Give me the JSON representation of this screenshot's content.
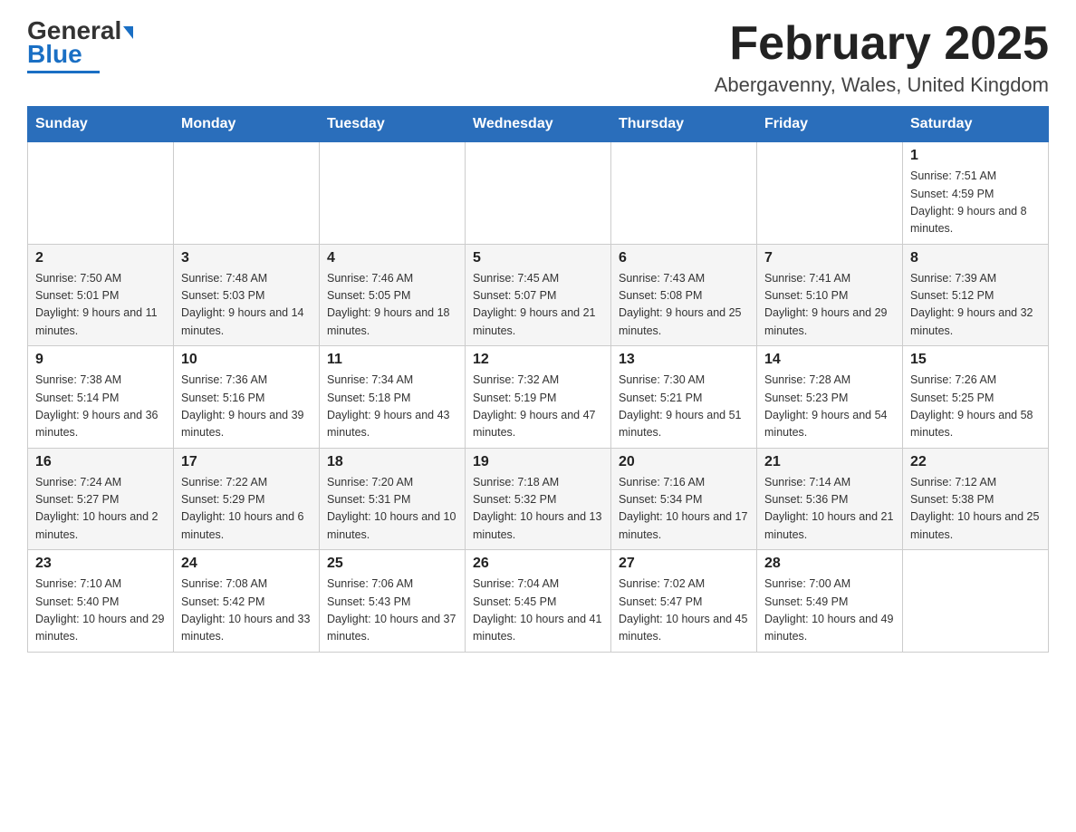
{
  "header": {
    "logo_general": "General",
    "logo_blue": "Blue",
    "month_title": "February 2025",
    "location": "Abergavenny, Wales, United Kingdom"
  },
  "days_of_week": [
    "Sunday",
    "Monday",
    "Tuesday",
    "Wednesday",
    "Thursday",
    "Friday",
    "Saturday"
  ],
  "weeks": [
    [
      {
        "day": "",
        "info": ""
      },
      {
        "day": "",
        "info": ""
      },
      {
        "day": "",
        "info": ""
      },
      {
        "day": "",
        "info": ""
      },
      {
        "day": "",
        "info": ""
      },
      {
        "day": "",
        "info": ""
      },
      {
        "day": "1",
        "info": "Sunrise: 7:51 AM\nSunset: 4:59 PM\nDaylight: 9 hours and 8 minutes."
      }
    ],
    [
      {
        "day": "2",
        "info": "Sunrise: 7:50 AM\nSunset: 5:01 PM\nDaylight: 9 hours and 11 minutes."
      },
      {
        "day": "3",
        "info": "Sunrise: 7:48 AM\nSunset: 5:03 PM\nDaylight: 9 hours and 14 minutes."
      },
      {
        "day": "4",
        "info": "Sunrise: 7:46 AM\nSunset: 5:05 PM\nDaylight: 9 hours and 18 minutes."
      },
      {
        "day": "5",
        "info": "Sunrise: 7:45 AM\nSunset: 5:07 PM\nDaylight: 9 hours and 21 minutes."
      },
      {
        "day": "6",
        "info": "Sunrise: 7:43 AM\nSunset: 5:08 PM\nDaylight: 9 hours and 25 minutes."
      },
      {
        "day": "7",
        "info": "Sunrise: 7:41 AM\nSunset: 5:10 PM\nDaylight: 9 hours and 29 minutes."
      },
      {
        "day": "8",
        "info": "Sunrise: 7:39 AM\nSunset: 5:12 PM\nDaylight: 9 hours and 32 minutes."
      }
    ],
    [
      {
        "day": "9",
        "info": "Sunrise: 7:38 AM\nSunset: 5:14 PM\nDaylight: 9 hours and 36 minutes."
      },
      {
        "day": "10",
        "info": "Sunrise: 7:36 AM\nSunset: 5:16 PM\nDaylight: 9 hours and 39 minutes."
      },
      {
        "day": "11",
        "info": "Sunrise: 7:34 AM\nSunset: 5:18 PM\nDaylight: 9 hours and 43 minutes."
      },
      {
        "day": "12",
        "info": "Sunrise: 7:32 AM\nSunset: 5:19 PM\nDaylight: 9 hours and 47 minutes."
      },
      {
        "day": "13",
        "info": "Sunrise: 7:30 AM\nSunset: 5:21 PM\nDaylight: 9 hours and 51 minutes."
      },
      {
        "day": "14",
        "info": "Sunrise: 7:28 AM\nSunset: 5:23 PM\nDaylight: 9 hours and 54 minutes."
      },
      {
        "day": "15",
        "info": "Sunrise: 7:26 AM\nSunset: 5:25 PM\nDaylight: 9 hours and 58 minutes."
      }
    ],
    [
      {
        "day": "16",
        "info": "Sunrise: 7:24 AM\nSunset: 5:27 PM\nDaylight: 10 hours and 2 minutes."
      },
      {
        "day": "17",
        "info": "Sunrise: 7:22 AM\nSunset: 5:29 PM\nDaylight: 10 hours and 6 minutes."
      },
      {
        "day": "18",
        "info": "Sunrise: 7:20 AM\nSunset: 5:31 PM\nDaylight: 10 hours and 10 minutes."
      },
      {
        "day": "19",
        "info": "Sunrise: 7:18 AM\nSunset: 5:32 PM\nDaylight: 10 hours and 13 minutes."
      },
      {
        "day": "20",
        "info": "Sunrise: 7:16 AM\nSunset: 5:34 PM\nDaylight: 10 hours and 17 minutes."
      },
      {
        "day": "21",
        "info": "Sunrise: 7:14 AM\nSunset: 5:36 PM\nDaylight: 10 hours and 21 minutes."
      },
      {
        "day": "22",
        "info": "Sunrise: 7:12 AM\nSunset: 5:38 PM\nDaylight: 10 hours and 25 minutes."
      }
    ],
    [
      {
        "day": "23",
        "info": "Sunrise: 7:10 AM\nSunset: 5:40 PM\nDaylight: 10 hours and 29 minutes."
      },
      {
        "day": "24",
        "info": "Sunrise: 7:08 AM\nSunset: 5:42 PM\nDaylight: 10 hours and 33 minutes."
      },
      {
        "day": "25",
        "info": "Sunrise: 7:06 AM\nSunset: 5:43 PM\nDaylight: 10 hours and 37 minutes."
      },
      {
        "day": "26",
        "info": "Sunrise: 7:04 AM\nSunset: 5:45 PM\nDaylight: 10 hours and 41 minutes."
      },
      {
        "day": "27",
        "info": "Sunrise: 7:02 AM\nSunset: 5:47 PM\nDaylight: 10 hours and 45 minutes."
      },
      {
        "day": "28",
        "info": "Sunrise: 7:00 AM\nSunset: 5:49 PM\nDaylight: 10 hours and 49 minutes."
      },
      {
        "day": "",
        "info": ""
      }
    ]
  ]
}
